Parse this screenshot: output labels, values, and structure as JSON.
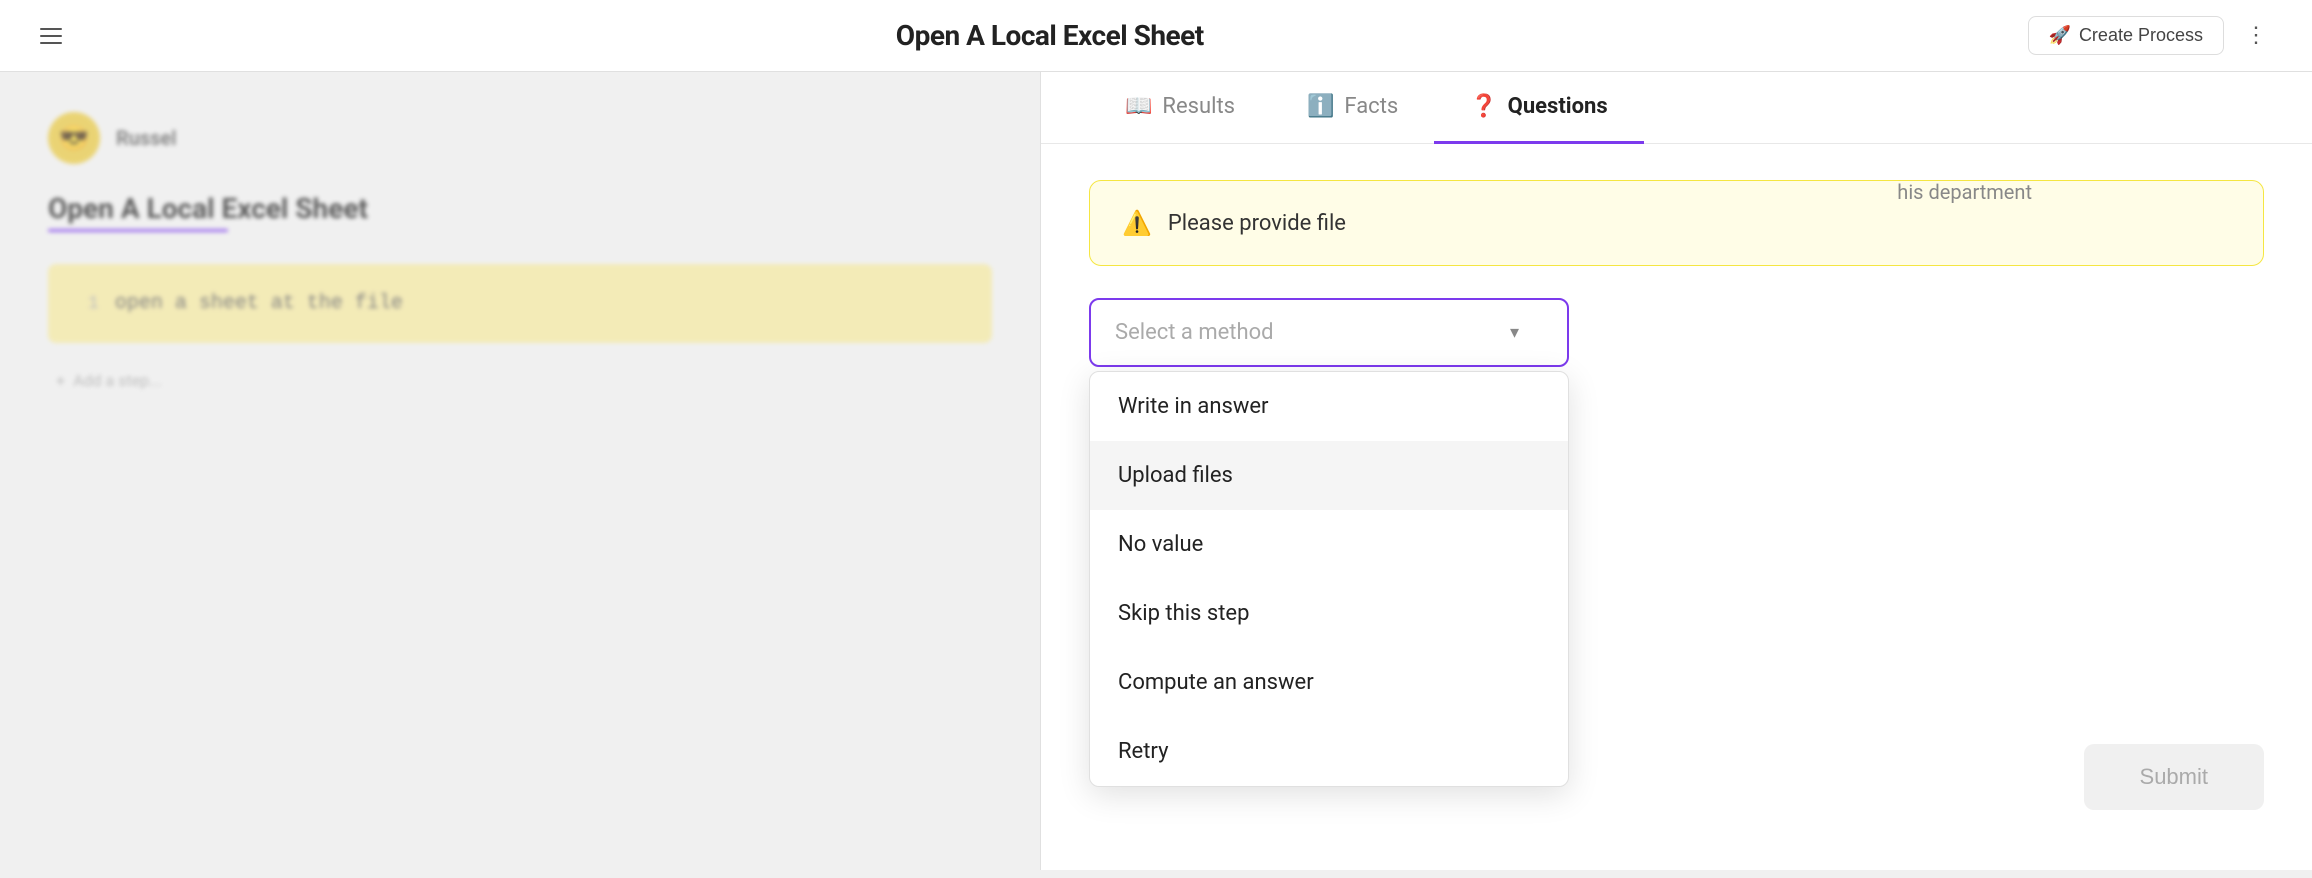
{
  "topbar": {
    "title": "Open A Local Excel Sheet",
    "create_process_label": "Create Process",
    "menu_icon": "☰"
  },
  "blurred_area": {
    "process_name": "Russel",
    "avatar_emoji": "😎",
    "main_title": "Open A Local Excel Sheet",
    "step_text": "open a sheet at the file",
    "step_num": "1",
    "add_step_label": "Add a step..."
  },
  "panel": {
    "tabs": [
      {
        "id": "results",
        "label": "Results",
        "icon": "📖",
        "active": false
      },
      {
        "id": "facts",
        "label": "Facts",
        "icon": "ℹ️",
        "active": false
      },
      {
        "id": "questions",
        "label": "Questions",
        "icon": "❓",
        "active": true
      }
    ],
    "warning_text": "Please provide file",
    "select_placeholder": "Select a method",
    "dropdown_items": [
      {
        "id": "write-in",
        "label": "Write in answer"
      },
      {
        "id": "upload-files",
        "label": "Upload files"
      },
      {
        "id": "no-value",
        "label": "No value"
      },
      {
        "id": "skip",
        "label": "Skip this step"
      },
      {
        "id": "compute",
        "label": "Compute an answer"
      },
      {
        "id": "retry",
        "label": "Retry"
      }
    ],
    "dept_text": "his department",
    "submit_label": "Submit"
  }
}
